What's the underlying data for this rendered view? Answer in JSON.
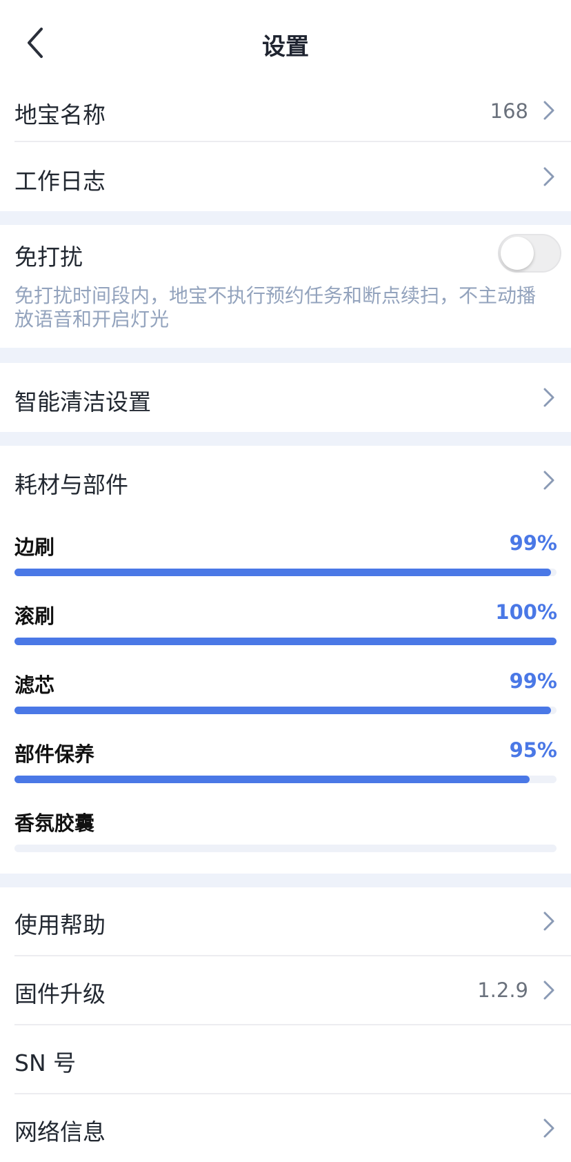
{
  "header": {
    "title": "设置",
    "back_icon": "chevron-left-icon"
  },
  "rows": {
    "robot_name": {
      "label": "地宝名称",
      "value": "168"
    },
    "work_log": {
      "label": "工作日志"
    },
    "dnd": {
      "label": "免打扰",
      "enabled": false,
      "description": "免打扰时间段内，地宝不执行预约任务和断点续扫，不主动播放语音和开启灯光"
    },
    "smart_clean": {
      "label": "智能清洁设置"
    },
    "consumables": {
      "label": "耗材与部件"
    },
    "help": {
      "label": "使用帮助"
    },
    "firmware": {
      "label": "固件升级",
      "value": "1.2.9"
    },
    "sn": {
      "label": "SN 号"
    },
    "network": {
      "label": "网络信息"
    }
  },
  "parts": [
    {
      "label": "边刷",
      "percent_text": "99%",
      "percent": 99
    },
    {
      "label": "滚刷",
      "percent_text": "100%",
      "percent": 100
    },
    {
      "label": "滤芯",
      "percent_text": "99%",
      "percent": 99
    },
    {
      "label": "部件保养",
      "percent_text": "95%",
      "percent": 95
    },
    {
      "label": "香氛胶囊",
      "percent_text": "",
      "percent": 0
    }
  ],
  "colors": {
    "accent": "#4a78e6",
    "section_gap": "#eef2fa",
    "description_text": "#93a3bd",
    "chevron": "#8a9ab5"
  }
}
